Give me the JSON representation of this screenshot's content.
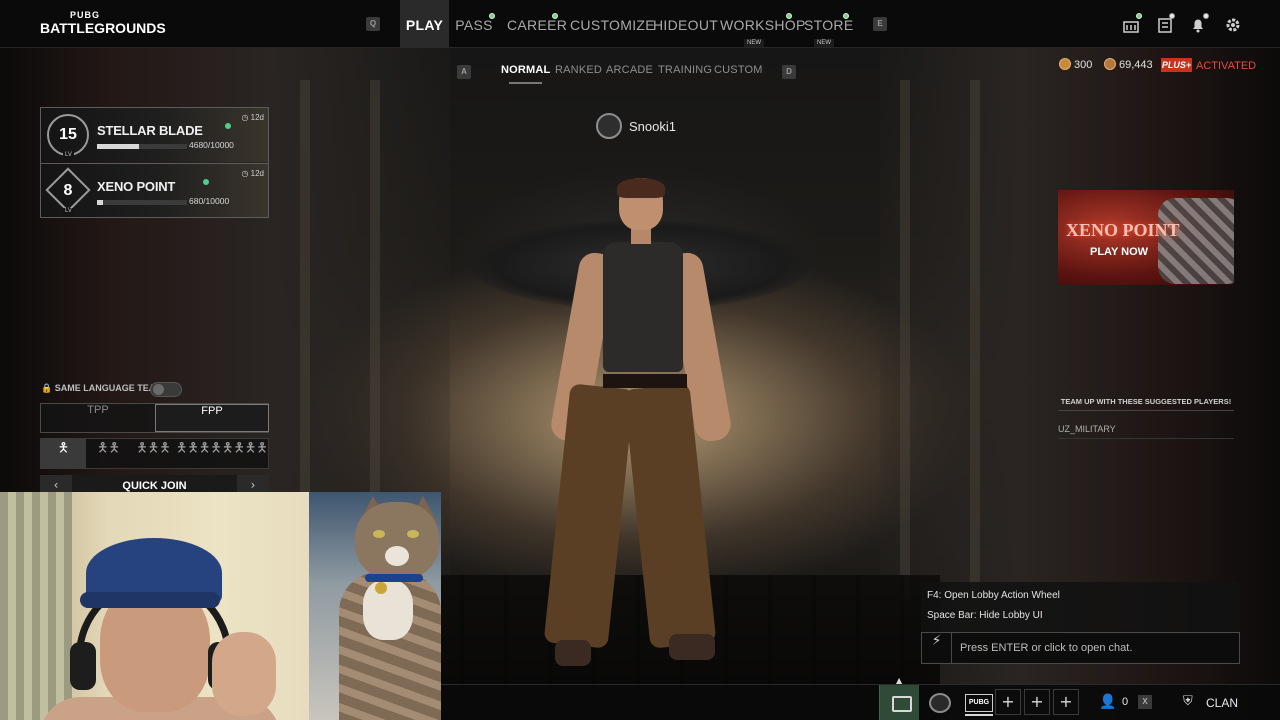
{
  "logo": {
    "top": "PUBG",
    "bottom": "BATTLEGROUNDS"
  },
  "nav": {
    "q_key": "Q",
    "e_key": "E",
    "items": [
      {
        "label": "PLAY",
        "active": true
      },
      {
        "label": "PASS",
        "dot": true
      },
      {
        "label": "CAREER",
        "dot": true
      },
      {
        "label": "CUSTOMIZE"
      },
      {
        "label": "HIDEOUT"
      },
      {
        "label": "WORKSHOP",
        "dot": true,
        "tag": "NEW"
      },
      {
        "label": "STORE",
        "dot": true,
        "tag": "NEW"
      }
    ]
  },
  "modes": {
    "a_key": "A",
    "d_key": "D",
    "items": [
      {
        "label": "NORMAL",
        "active": true
      },
      {
        "label": "RANKED"
      },
      {
        "label": "ARCADE"
      },
      {
        "label": "TRAINING"
      },
      {
        "label": "CUSTOM"
      }
    ]
  },
  "currency": {
    "coins": "300",
    "bp": "69,443",
    "plus_badge": "PLUS+",
    "plus_status": "ACTIVATED"
  },
  "player": {
    "name": "Snooki1"
  },
  "passes": [
    {
      "level": "15",
      "lv_label": "LV",
      "name": "STELLAR BLADE",
      "xp": "4680/10000",
      "progress": 0.468,
      "time": "12d"
    },
    {
      "level": "8",
      "lv_label": "LV",
      "name": "XENO POINT",
      "xp": "680/10000",
      "progress": 0.068,
      "time": "12d"
    }
  ],
  "team": {
    "same_language": "SAME LANGUAGE TEAM",
    "same_language_on": false,
    "perspectives": [
      {
        "label": "TPP"
      },
      {
        "label": "FPP",
        "active": true
      }
    ],
    "squad_sizes": [
      "solo",
      "duo",
      "trio",
      "squad",
      "custom-squad"
    ],
    "quick_join": "QUICK JOIN"
  },
  "banner": {
    "title": "XENO POINT",
    "cta": "PLAY NOW"
  },
  "suggested": {
    "heading": "TEAM UP WITH THESE SUGGESTED PLAYERS!",
    "players": [
      "UZ_MILITARY"
    ]
  },
  "chat": {
    "hints": [
      "F4: Open Lobby Action Wheel",
      "Space Bar: Hide Lobby UI"
    ],
    "placeholder": "Press ENTER or click to open chat."
  },
  "bottom": {
    "pubg_label": "PUBG",
    "slot_symbol": "+",
    "party_count": "0",
    "x_key": "X",
    "clan": "CLAN"
  },
  "colors": {
    "accent_green": "#7ad28f",
    "plus_red": "#c9331d",
    "activated_red": "#e0503a"
  }
}
